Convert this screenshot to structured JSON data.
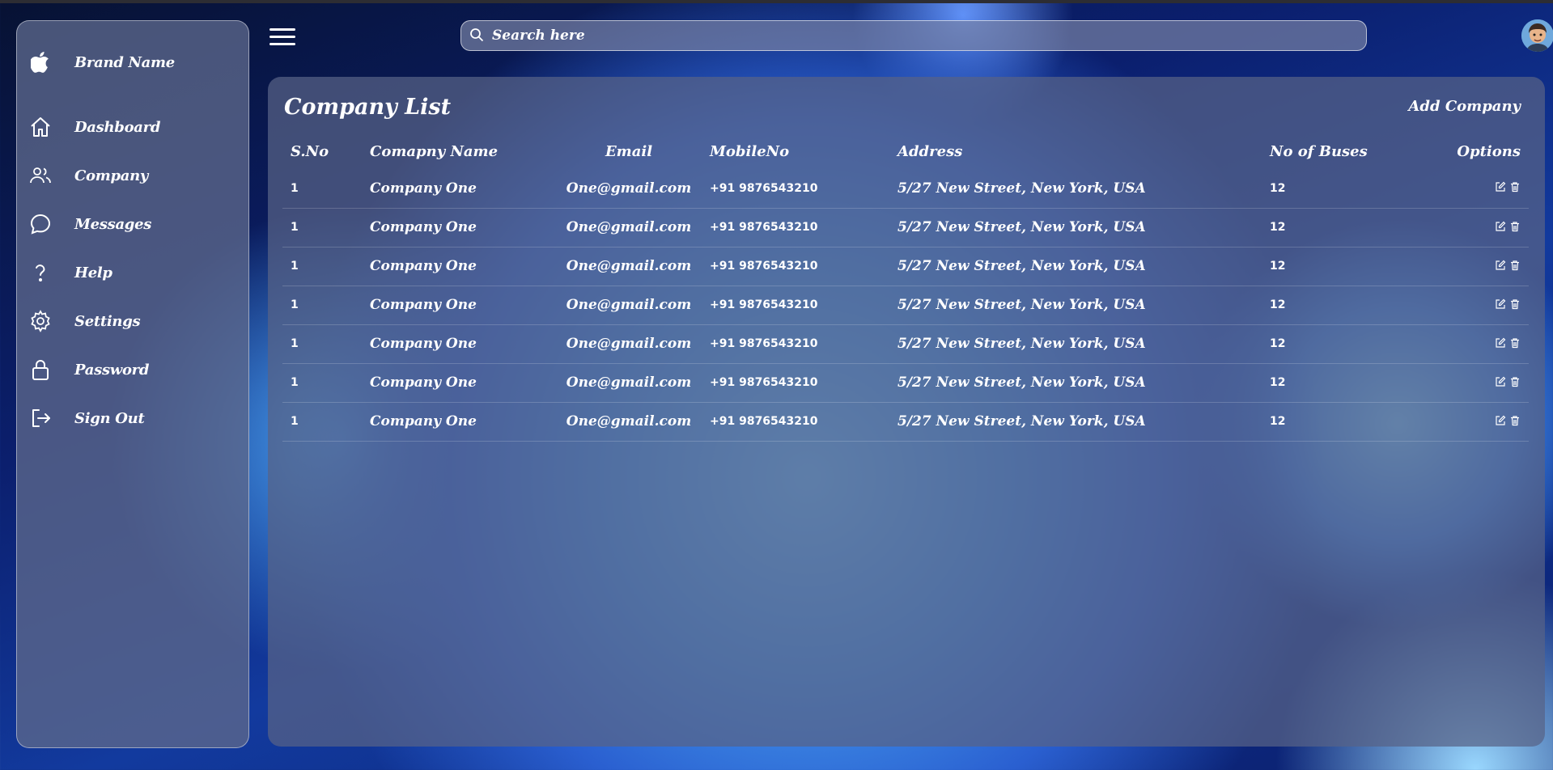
{
  "brand": {
    "name": "Brand Name",
    "icon": "apple-logo-icon"
  },
  "sidebar": {
    "items": [
      {
        "label": "Dashboard",
        "icon": "home-icon"
      },
      {
        "label": "Company",
        "icon": "users-icon"
      },
      {
        "label": "Messages",
        "icon": "chat-bubble-icon"
      },
      {
        "label": "Help",
        "icon": "question-icon"
      },
      {
        "label": "Settings",
        "icon": "gear-icon"
      },
      {
        "label": "Password",
        "icon": "lock-icon"
      },
      {
        "label": "Sign Out",
        "icon": "sign-out-icon"
      }
    ]
  },
  "header": {
    "search_placeholder": "Search here"
  },
  "main": {
    "title": "Company List",
    "add_button": "Add Company",
    "columns": [
      "S.No",
      "Comapny Name",
      "Email",
      "MobileNo",
      "Address",
      "No of Buses",
      "Options"
    ],
    "rows": [
      {
        "sno": "1",
        "name": "Company One",
        "email": "One@gmail.com",
        "mobile": "+91 9876543210",
        "address": "5/27 New Street, New York, USA",
        "buses": "12"
      },
      {
        "sno": "1",
        "name": "Company One",
        "email": "One@gmail.com",
        "mobile": "+91 9876543210",
        "address": "5/27 New Street, New York, USA",
        "buses": "12"
      },
      {
        "sno": "1",
        "name": "Company One",
        "email": "One@gmail.com",
        "mobile": "+91 9876543210",
        "address": "5/27 New Street, New York, USA",
        "buses": "12"
      },
      {
        "sno": "1",
        "name": "Company One",
        "email": "One@gmail.com",
        "mobile": "+91 9876543210",
        "address": "5/27 New Street, New York, USA",
        "buses": "12"
      },
      {
        "sno": "1",
        "name": "Company One",
        "email": "One@gmail.com",
        "mobile": "+91 9876543210",
        "address": "5/27 New Street, New York, USA",
        "buses": "12"
      },
      {
        "sno": "1",
        "name": "Company One",
        "email": "One@gmail.com",
        "mobile": "+91 9876543210",
        "address": "5/27 New Street, New York, USA",
        "buses": "12"
      },
      {
        "sno": "1",
        "name": "Company One",
        "email": "One@gmail.com",
        "mobile": "+91 9876543210",
        "address": "5/27 New Street, New York, USA",
        "buses": "12"
      }
    ]
  }
}
